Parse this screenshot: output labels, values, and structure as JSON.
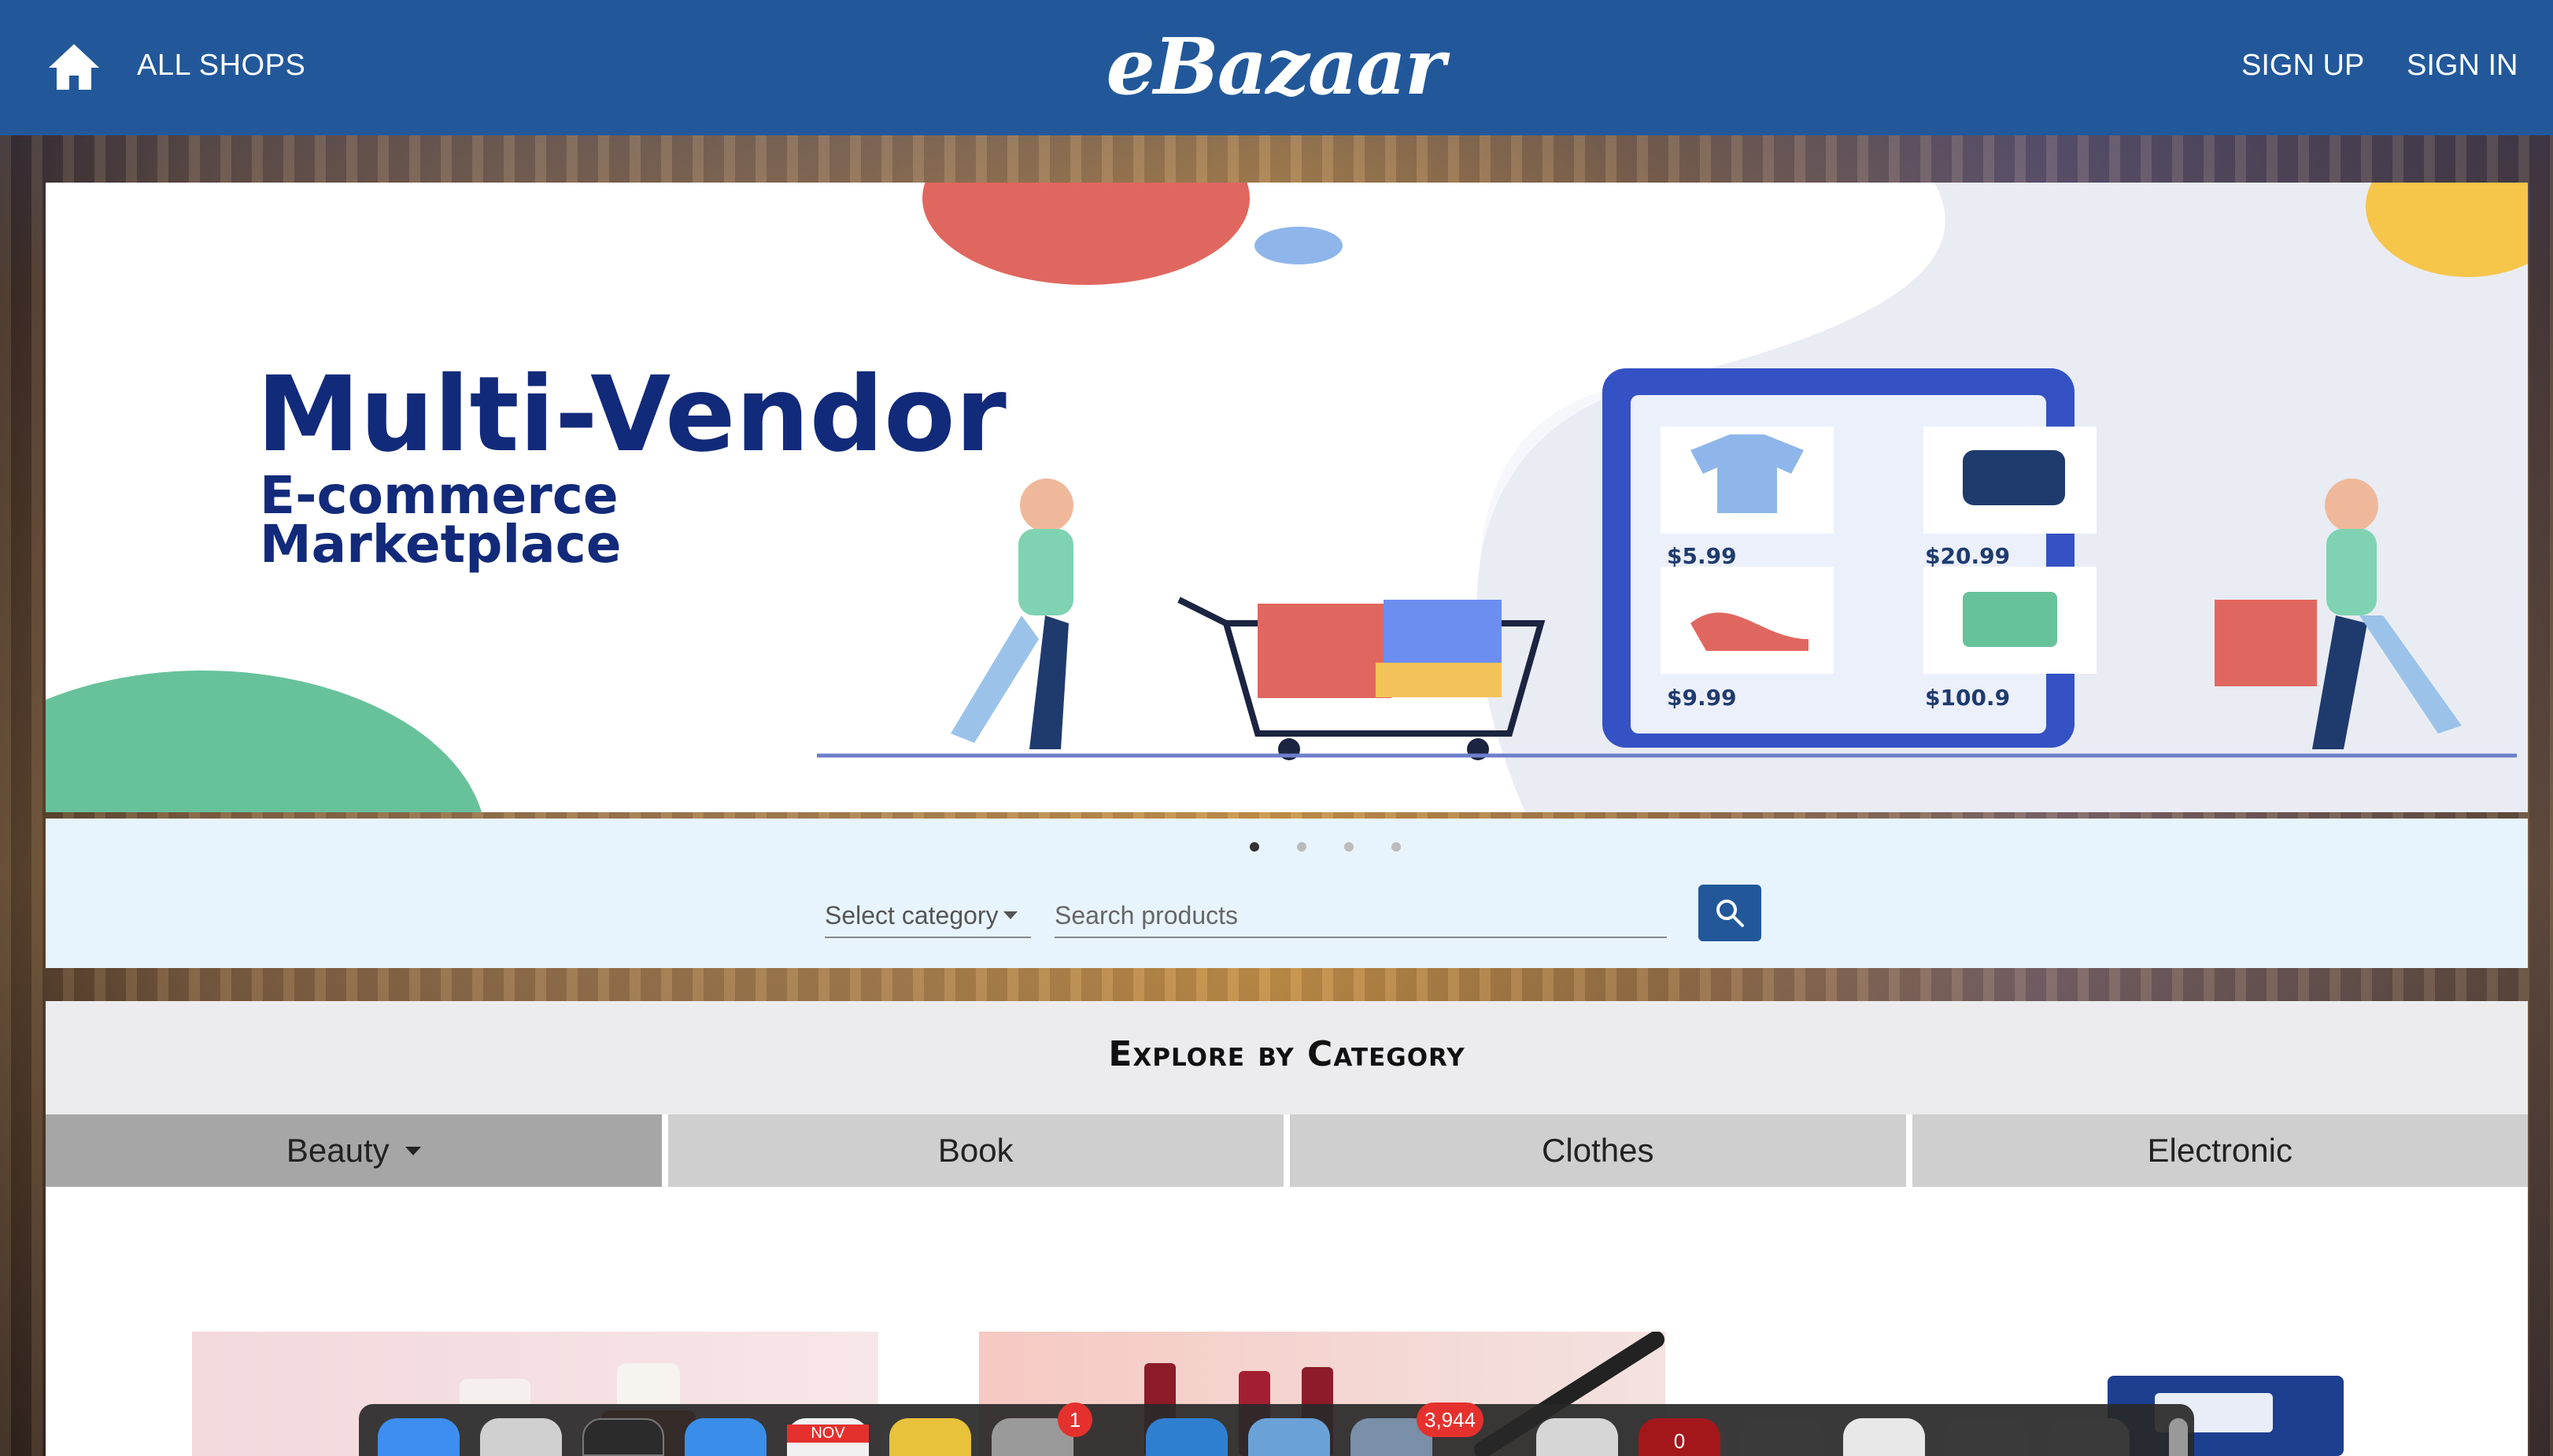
{
  "header": {
    "home_icon": "home-icon",
    "all_shops": "ALL SHOPS",
    "brand": "eBazaar",
    "sign_up": "SIGN UP",
    "sign_in": "SIGN IN",
    "bar_color": "#22589a"
  },
  "hero": {
    "headline": "Multi-Vendor",
    "sub_line_1": "E-commerce",
    "sub_line_2": "Marketplace",
    "prices": [
      "$5.99",
      "$20.99",
      "$9.99",
      "$100.9"
    ],
    "slide_count": 4,
    "active_slide": 1
  },
  "search": {
    "category_placeholder": "Select category",
    "search_placeholder": "Search products",
    "search_icon": "search-icon"
  },
  "explore": {
    "title": "Explore by Category",
    "tabs": [
      {
        "label": "Beauty",
        "active": true
      },
      {
        "label": "Book",
        "active": false
      },
      {
        "label": "Clothes",
        "active": false
      },
      {
        "label": "Electronic",
        "active": false
      }
    ]
  },
  "dock": {
    "badges": [
      "1",
      "3,944",
      "0"
    ],
    "calendar_month": "NOV"
  }
}
